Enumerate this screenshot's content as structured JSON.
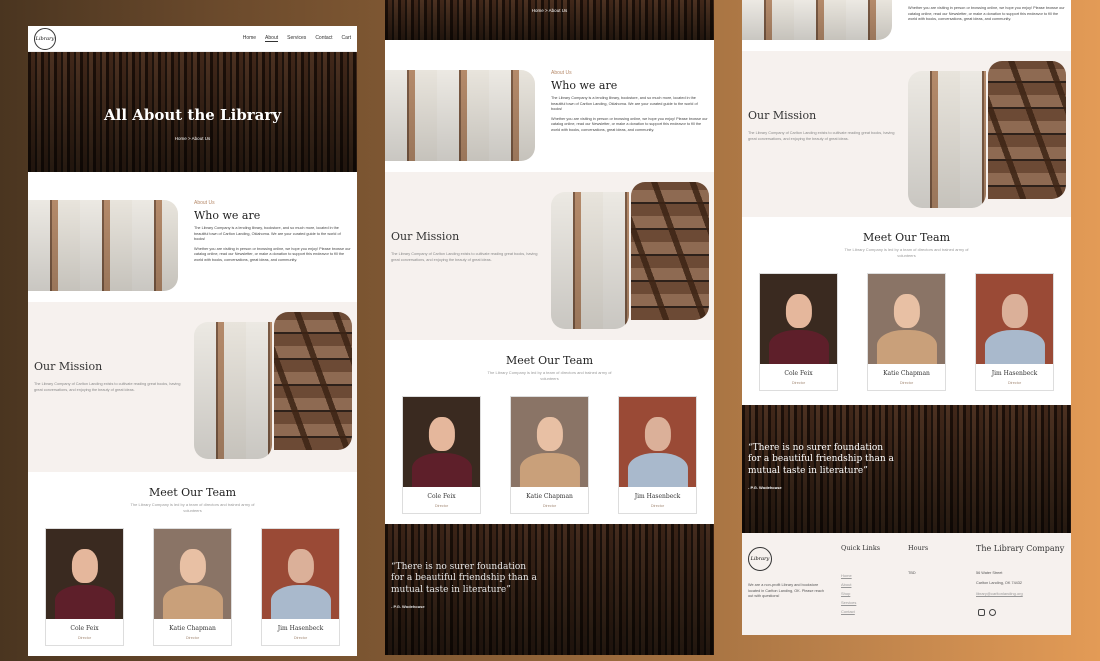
{
  "nav": {
    "items": [
      "Home",
      "About",
      "Services",
      "Contact",
      "Cart"
    ],
    "active": "About",
    "logo_text": "Library"
  },
  "hero": {
    "title": "All About the Library",
    "breadcrumb": "Home > About Us"
  },
  "about": {
    "eyebrow": "About Us",
    "title": "Who we are",
    "p1": "The Library Company is a lending library, bookstore, and so much more, located in the beautiful town of Carlton Landing, Oklahoma. We are your curated guide to the world of books!",
    "p2": "Whether you are visiting in person or browsing online, we hope you enjoy! Please browse our catalog online, read our Newsletter, or make a donation to support this endeavor to fill the world with books, conversations, great ideas, and community."
  },
  "mission": {
    "title": "Our Mission",
    "text": "The Library Company of Carlton Landing exists to cultivate reading great books, having great conversations, and enjoying the beauty of great ideas."
  },
  "team": {
    "title": "Meet Our Team",
    "subtitle": "The Library Company is led by a team of directors and trained army of volunteers",
    "members": [
      {
        "name": "Cole Feix",
        "role": "Director"
      },
      {
        "name": "Katie Chapman",
        "role": "Director"
      },
      {
        "name": "Jim Hasenbeck",
        "role": "Director"
      }
    ]
  },
  "quote": {
    "text": "“There is no surer foundation for a beautiful friendship than a mutual taste in literature”",
    "author": "- P.G. Wodehouse"
  },
  "footer": {
    "about_text": "We are a non-profit Library and bookstore located in Carlton Landing, OK. Please reach out with questions!",
    "quick_links_title": "Quick Links",
    "quick_links": [
      "Home",
      "About",
      "Shop",
      "Services",
      "Contact"
    ],
    "hours_title": "Hours",
    "hours_text": "TBD",
    "company_title": "The Library Company",
    "address_line1": "56 Water Street",
    "address_line2": "Carlton Landing, OK 74432",
    "email": "library@carltonlanding.org"
  },
  "colors": {
    "accent": "#b68a6a",
    "mission_bg": "#f6f1ee",
    "background_gradient_start": "#4a3520",
    "background_gradient_end": "#e39b56"
  }
}
